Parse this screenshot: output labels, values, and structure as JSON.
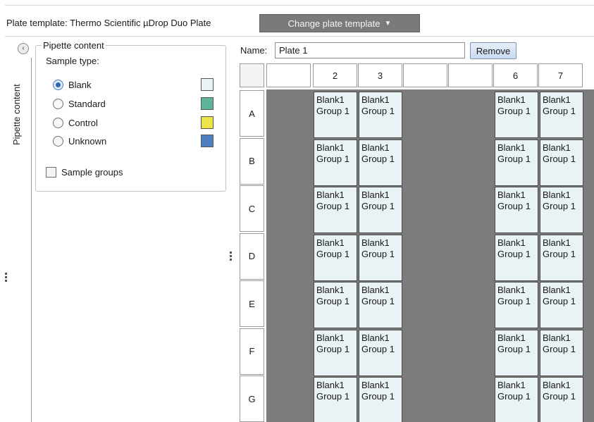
{
  "top_bar": {
    "plate_template_label": "Plate template:  Thermo Scientific µDrop Duo Plate",
    "change_template_button": "Change plate template",
    "change_template_caret": "▼"
  },
  "left_strip": {
    "collapse_glyph": "‹",
    "vertical_title": "Pipette content"
  },
  "pipette_panel": {
    "group_title": "Pipette content",
    "sample_type_label": "Sample type:",
    "sample_types": [
      {
        "label": "Blank",
        "checked": true,
        "color": "#eaf3f5"
      },
      {
        "label": "Standard",
        "checked": false,
        "color": "#5fb39a"
      },
      {
        "label": "Control",
        "checked": false,
        "color": "#ede44a"
      },
      {
        "label": "Unknown",
        "checked": false,
        "color": "#4f7ec1"
      }
    ],
    "sample_groups_label": "Sample groups",
    "sample_groups_checked": false
  },
  "plate_editor": {
    "name_label": "Name:",
    "name_value": "Plate 1",
    "remove_button": "Remove",
    "columns": [
      "",
      "2",
      "3",
      "",
      "",
      "6",
      "7"
    ],
    "rows": [
      "A",
      "B",
      "C",
      "D",
      "E",
      "F",
      "G"
    ],
    "filled_columns": [
      "2",
      "3",
      "6",
      "7"
    ],
    "well_line1": "Blank1",
    "well_line2": "Group 1"
  },
  "colors": {
    "empty_well_area": "#7c7c7c",
    "blank_well_fill": "#e9f3f6",
    "template_button_bg": "#7a7a7a"
  }
}
